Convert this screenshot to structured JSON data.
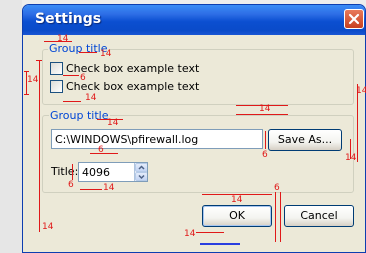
{
  "window": {
    "title": "Settings"
  },
  "group1": {
    "title": "Group title",
    "checkboxes": [
      {
        "label": "Check box example text",
        "checked": false
      },
      {
        "label": "Check box example text",
        "checked": false
      }
    ]
  },
  "group2": {
    "title": "Group title",
    "path_value": "C:\\WINDOWS\\pfirewall.log",
    "save_as_label": "Save As...",
    "title_label": "Title:",
    "size_value": "4096"
  },
  "buttons": {
    "ok_label": "OK",
    "cancel_label": "Cancel"
  },
  "annotations": {
    "top_group_margin": "14",
    "left_window_margin": "14",
    "left_group_margin": "14",
    "cb_spacing": "6",
    "below_cb": "14",
    "between_groups": "14",
    "group2_title": "14",
    "right_group": "14",
    "textbox_gap": "6",
    "save_as_bottom": "14",
    "title_gap": "6",
    "title_bottom": "14",
    "buttons_top": "14",
    "buttons_gap": "6",
    "left_bottom": "14",
    "bottom": "14",
    "colors": {
      "annotation": "#e01919",
      "accent": "#0046d5"
    }
  }
}
